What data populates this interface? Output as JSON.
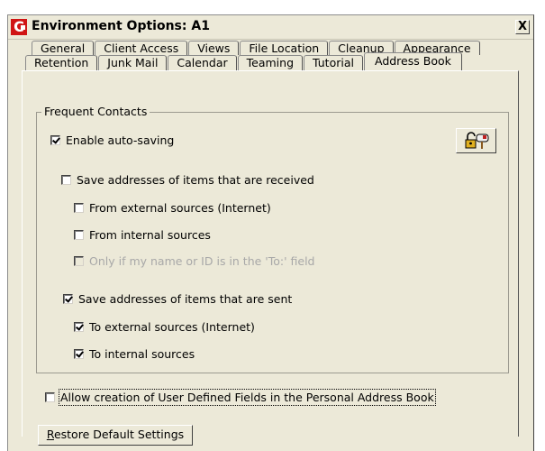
{
  "window": {
    "title": "Environment Options:  A1",
    "close_label": "X",
    "app_icon_label": "C"
  },
  "tabs": {
    "back_row": [
      "General",
      "Client Access",
      "Views",
      "File Location",
      "Cleanup",
      "Appearance"
    ],
    "front_row": [
      "Retention",
      "Junk Mail",
      "Calendar",
      "Teaming",
      "Tutorial",
      "Address Book"
    ],
    "active": "Address Book"
  },
  "frequent_contacts": {
    "group_label": "Frequent Contacts",
    "enable_auto_saving": {
      "label": "Enable auto-saving",
      "checked": true
    },
    "save_received": {
      "label": "Save addresses of items that are received",
      "checked": false
    },
    "from_external": {
      "label": "From external sources (Internet)",
      "checked": false
    },
    "from_internal": {
      "label": "From internal sources",
      "checked": false
    },
    "only_if_my_name": {
      "label": "Only if my name or ID is in the 'To:' field",
      "checked": false,
      "disabled": true
    },
    "save_sent": {
      "label": "Save addresses of items that are sent",
      "checked": true
    },
    "to_external": {
      "label": "To external sources (Internet)",
      "checked": true
    },
    "to_internal": {
      "label": "To internal sources",
      "checked": true
    },
    "lock_icon": "unlock-mailbox-icon"
  },
  "allow_user_defined": {
    "label": "Allow creation of User Defined Fields in the Personal Address Book",
    "checked": false
  },
  "restore": {
    "label_first": "R",
    "label_rest": "estore Default Settings"
  }
}
